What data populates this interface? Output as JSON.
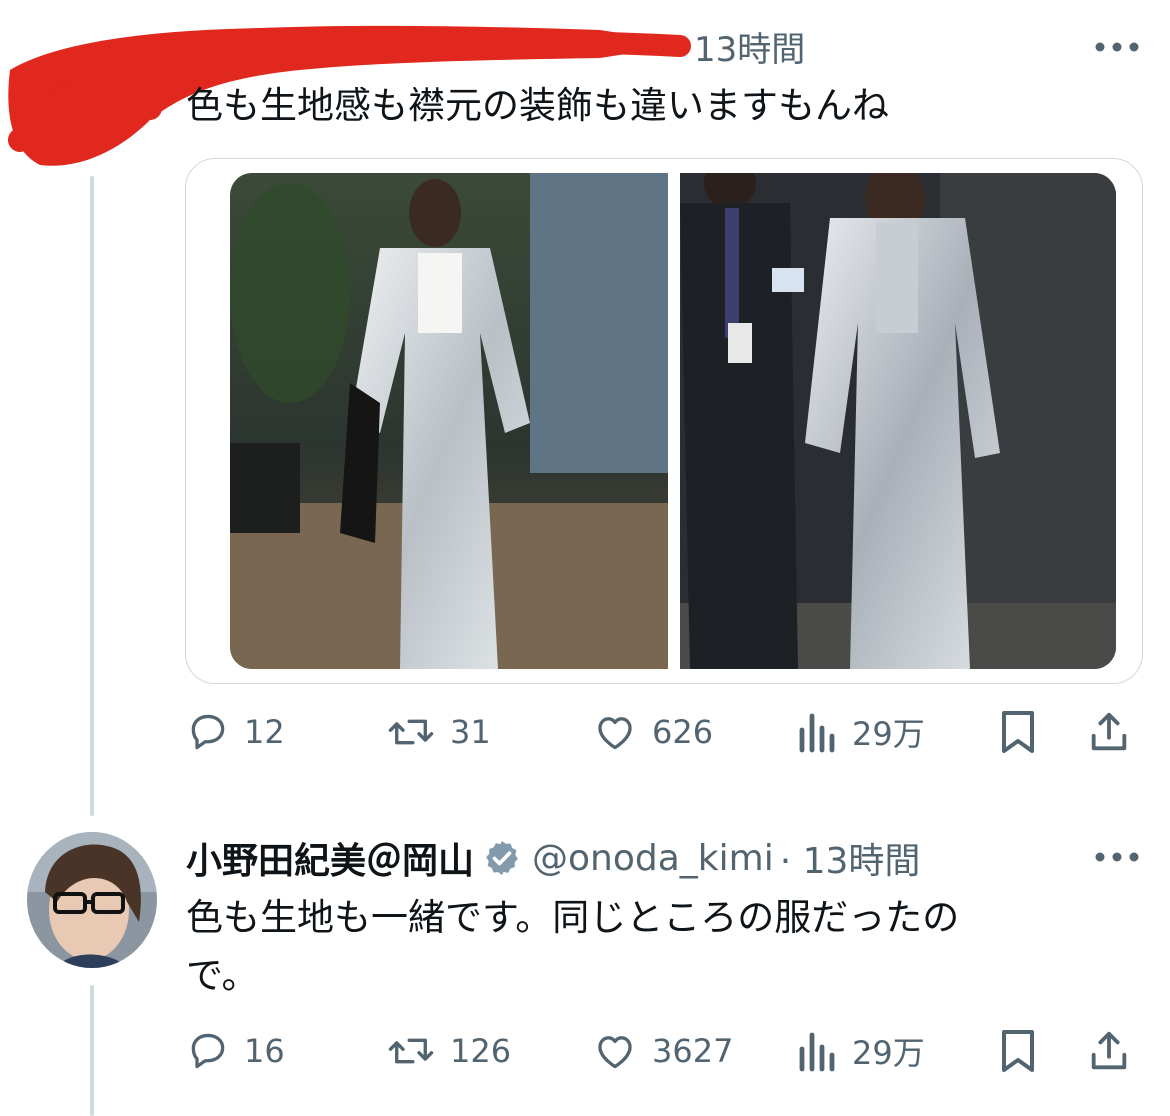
{
  "tweet1": {
    "time": "13時間",
    "text": "色も生地感も襟元の装飾も違いますもんね",
    "media": [
      {
        "description": "photo-left-silver-suit"
      },
      {
        "description": "photo-right-silver-suit"
      }
    ],
    "stats": {
      "replies": "12",
      "retweets": "31",
      "likes": "626",
      "views": "29万"
    }
  },
  "tweet2": {
    "name": "小野田紀美＠岡山",
    "handle": "@onoda_kimi",
    "time": "· 13時間",
    "text_line1": "色も生地も一緒です。同じところの服だったの",
    "text_line2": "で。",
    "stats": {
      "replies": "16",
      "retweets": "126",
      "likes": "3627",
      "views": "29万"
    }
  },
  "icons": [
    "more-icon",
    "reply-icon",
    "retweet-icon",
    "like-icon",
    "views-icon",
    "bookmark-icon",
    "share-icon",
    "verified-badge-icon"
  ],
  "colors": {
    "text": "#0f1419",
    "muted": "#536471",
    "border": "#cfd9de",
    "redaction": "#e0281e",
    "verified": "#829aab"
  }
}
